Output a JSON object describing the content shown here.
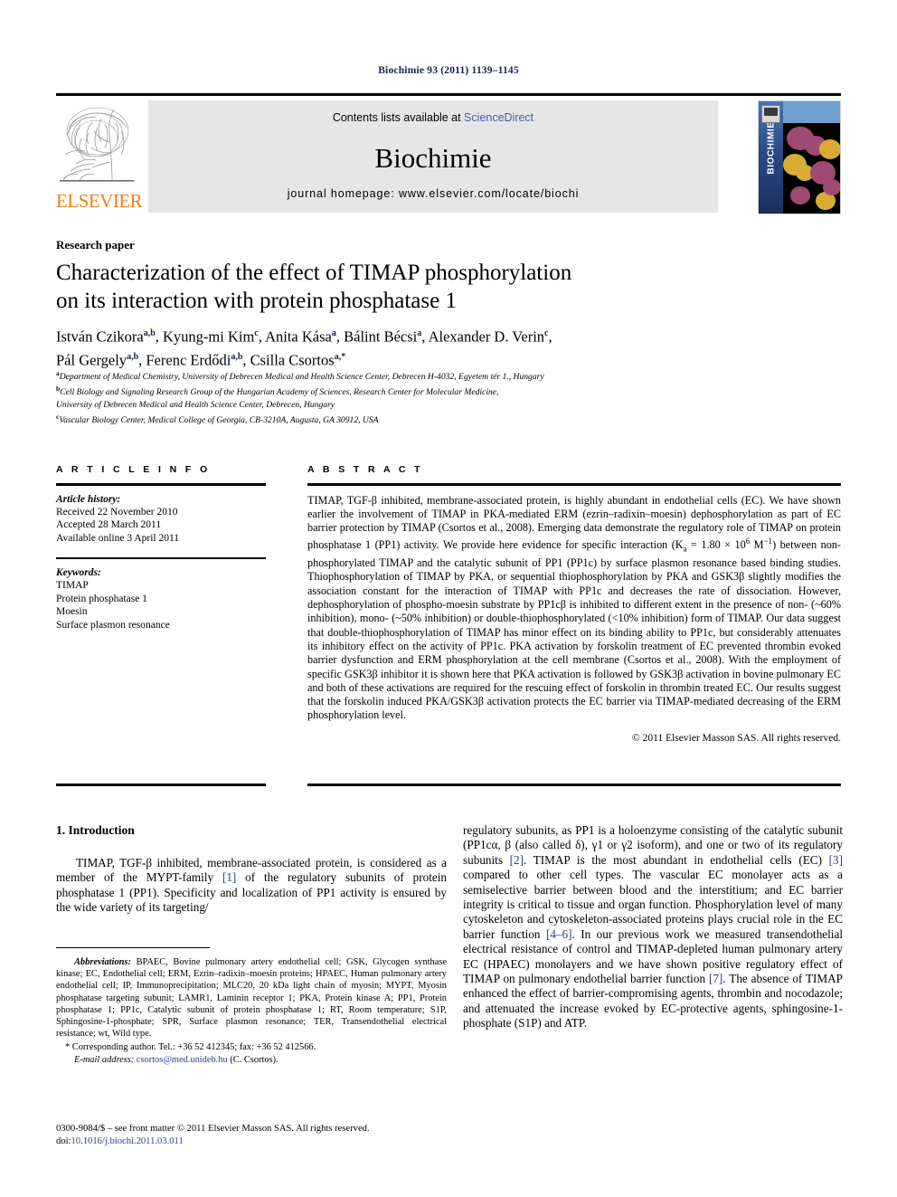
{
  "running_head": "Biochimie 93 (2011) 1139–1145",
  "masthead": {
    "contents_prefix": "Contents lists available at ",
    "contents_link": "ScienceDirect",
    "journal_name": "Biochimie",
    "homepage": "journal homepage: www.elsevier.com/locate/biochi",
    "publisher_wordmark": "ELSEVIER",
    "cover_spine_title": "BIOCHIMIE",
    "publisher_color": "#f07f13",
    "link_color": "#3a63ad",
    "band_color": "#e6e6e6"
  },
  "article": {
    "type": "Research paper",
    "title_line1": "Characterization of the effect of TIMAP phosphorylation",
    "title_line2": "on its interaction with protein phosphatase 1",
    "authors": [
      {
        "name": "István Czikora",
        "sup": "a,b",
        "sep": ", "
      },
      {
        "name": "Kyung-mi Kim",
        "sup": "c",
        "sep": ", "
      },
      {
        "name": "Anita Kása",
        "sup": "a",
        "sep": ", "
      },
      {
        "name": "Bálint Bécsi",
        "sup": "a",
        "sep": ", "
      },
      {
        "name": "Alexander D. Verin",
        "sup": "c",
        "sep": ", "
      },
      {
        "name": "Pál Gergely",
        "sup": "a,b",
        "sep": ", "
      },
      {
        "name": "Ferenc Erdődi",
        "sup": "a,b",
        "sep": ", "
      },
      {
        "name": "Csilla Csortos",
        "sup": "a,*",
        "sep": ""
      }
    ],
    "affiliations": [
      {
        "mark": "a",
        "text": "Department of Medical Chemistry, University of Debrecen Medical and Health Science Center, Debrecen H-4032, Egyetem tér 1., Hungary"
      },
      {
        "mark": "b",
        "text": "Cell Biology and Signaling Research Group of the Hungarian Academy of Sciences, Research Center for Molecular Medicine,"
      },
      {
        "mark": "",
        "text": "University of Debrecen Medical and Health Science Center, Debrecen, Hungary"
      },
      {
        "mark": "c",
        "text": "Vascular Biology Center, Medical College of Georgia, CB-3210A, Augusta, GA 30912, USA"
      }
    ]
  },
  "article_info": {
    "heading": "A R T I C L E   I N F O",
    "history_label": "Article history:",
    "history": [
      "Received 22 November 2010",
      "Accepted 28 March 2011",
      "Available online 3 April 2011"
    ],
    "keywords_label": "Keywords:",
    "keywords": [
      "TIMAP",
      "Protein phosphatase 1",
      "Moesin",
      "Surface plasmon resonance"
    ]
  },
  "abstract": {
    "heading": "A B S T R A C T",
    "part1": "TIMAP, TGF-β inhibited, membrane-associated protein, is highly abundant in endothelial cells (EC). We have shown earlier the involvement of TIMAP in PKA-mediated ERM (ezrin–radixin–moesin) dephosphorylation as part of EC barrier protection by TIMAP (Csortos et al., 2008). Emerging data demonstrate the regulatory role of TIMAP on protein phosphatase 1 (PP1) activity. We provide here evidence for specific interaction (K",
    "ka_sub": "a",
    "part2": " = 1.80 × 10",
    "exp1": "6",
    "part3": " M",
    "exp2": "−1",
    "part4": ") between non-phosphorylated TIMAP and the catalytic subunit of PP1 (PP1c) by surface plasmon resonance based binding studies. Thiophosphorylation of TIMAP by PKA, or sequential thiophosphorylation by PKA and GSK3β slightly modifies the association constant for the interaction of TIMAP with PP1c and decreases the rate of dissociation. However, dephosphorylation of phospho-moesin substrate by PP1cβ is inhibited to different extent in the presence of non- (~60% inhibition), mono- (~50% inhibition) or double-thiophosphorylated (<10% inhibition) form of TIMAP. Our data suggest that double-thiophosphorylation of TIMAP has minor effect on its binding ability to PP1c, but considerably attenuates its inhibitory effect on the activity of PP1c. PKA activation by forskolin treatment of EC prevented thrombin evoked barrier dysfunction and ERM phosphorylation at the cell membrane (Csortos et al., 2008). With the employment of specific GSK3β inhibitor it is shown here that PKA activation is followed by GSK3β activation in bovine pulmonary EC and both of these activations are required for the rescuing effect of forskolin in thrombin treated EC. Our results suggest that the forskolin induced PKA/GSK3β activation protects the EC barrier via TIMAP-mediated decreasing of the ERM phosphorylation level.",
    "copyright": "© 2011 Elsevier Masson SAS. All rights reserved."
  },
  "introduction": {
    "heading": "1. Introduction",
    "left_para_a": "TIMAP, TGF-β inhibited, membrane-associated protein, is considered as a member of the MYPT-family ",
    "left_ref1": "[1]",
    "left_para_b": " of the regulatory subunits of protein phosphatase 1 (PP1). Specificity and localization of PP1 activity is ensured by the wide variety of its targeting/",
    "right_para_a": "regulatory subunits, as PP1 is a holoenzyme consisting of the catalytic subunit (PP1cα, β (also called δ), γ1 or γ2 isoform), and one or two of its regulatory subunits ",
    "right_ref2": "[2]",
    "right_para_b": ". TIMAP is the most abundant in endothelial cells (EC) ",
    "right_ref3": "[3]",
    "right_para_c": " compared to other cell types. The vascular EC monolayer acts as a semiselective barrier between blood and the interstitium; and EC barrier integrity is critical to tissue and organ function. Phosphorylation level of many cytoskeleton and cytoskeleton-associated proteins plays crucial role in the EC barrier function ",
    "right_ref4": "[4–6]",
    "right_para_d": ". In our previous work we measured transendothelial electrical resistance of control and TIMAP-depleted human pulmonary artery EC (HPAEC) monolayers and we have shown positive regulatory effect of TIMAP on pulmonary endothelial barrier function ",
    "right_ref5": "[7]",
    "right_para_e": ". The absence of TIMAP enhanced the effect of barrier-compromising agents, thrombin and nocodazole; and attenuated the increase evoked by EC-protective agents, sphingosine-1-phosphate (S1P) and ATP."
  },
  "footnotes": {
    "abbr_label": "Abbreviations:",
    "abbr_text": " BPAEC, Bovine pulmonary artery endothelial cell; GSK, Glycogen synthase kinase; EC, Endothelial cell; ERM, Ezrin–radixin–moesin proteins; HPAEC, Human pulmonary artery endothelial cell; IP, Immunoprecipitation; MLC20, 20 kDa light chain of myosin; MYPT, Myosin phosphatase targeting subunit; LAMR1, Laminin receptor 1; PKA, Protein kinase A; PP1, Protein phosphatase 1; PP1c, Catalytic subunit of protein phosphatase 1; RT, Room temperature; S1P, Sphingosine-1-phosphate; SPR, Surface plasmon resonance; TER, Transendothelial electrical resistance; wt, Wild type.",
    "corresponding": "* Corresponding author. Tel.: +36 52 412345; fax: +36 52 412566.",
    "email_label": "E-mail address:",
    "email": "csortos@med.unideb.hu",
    "email_suffix": " (C. Csortos).",
    "imprint_line1": "0300-9084/$ – see front matter © 2011 Elsevier Masson SAS. All rights reserved.",
    "imprint_doi_label": "doi:",
    "imprint_doi": "10.1016/j.biochi.2011.03.011"
  }
}
